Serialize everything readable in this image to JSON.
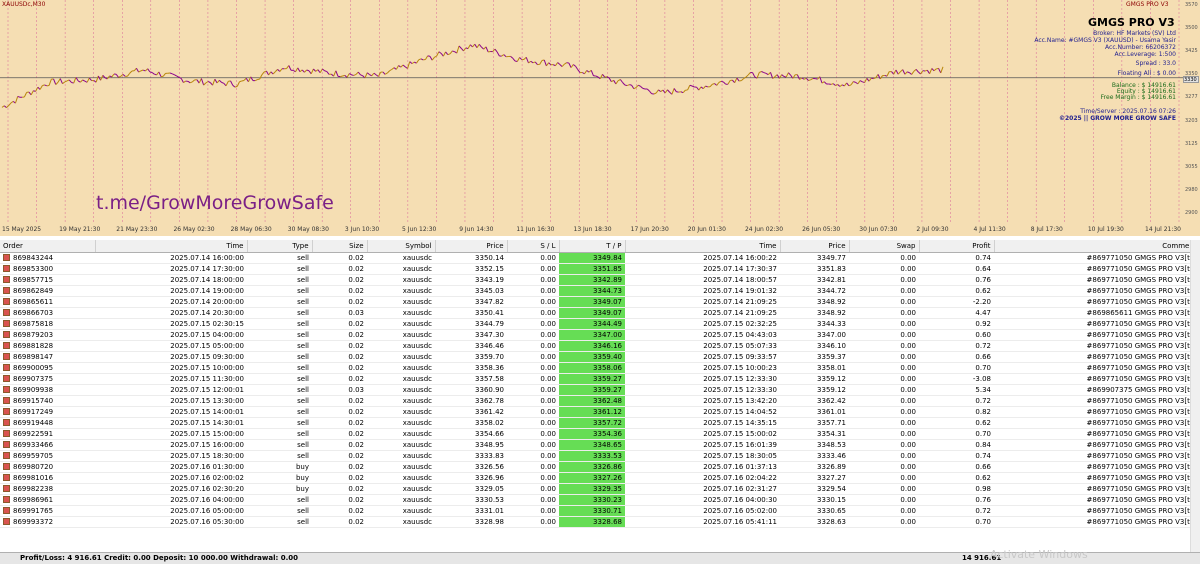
{
  "chart": {
    "symbol_label": "XAUUSDc,M30",
    "ea_label": "GMGS PRO V3",
    "watermark": "t.me/GrowMoreGrowSafe",
    "current_price": "3330",
    "y_labels": [
      "3570",
      "3500",
      "3425",
      "3350",
      "3277",
      "3203",
      "3125",
      "3055",
      "2980",
      "2900"
    ],
    "x_labels": [
      "15 May 2025",
      "19 May 21:30",
      "21 May 23:30",
      "26 May 02:30",
      "28 May 06:30",
      "30 May 08:30",
      "3 Jun 10:30",
      "5 Jun 12:30",
      "9 Jun 14:30",
      "11 Jun 16:30",
      "13 Jun 18:30",
      "17 Jun 20:30",
      "20 Jun 01:30",
      "24 Jun 02:30",
      "26 Jun 05:30",
      "30 Jun 07:30",
      "2 Jul 09:30",
      "4 Jul 11:30",
      "8 Jul 17:30",
      "10 Jul 19:30",
      "14 Jul 21:30"
    ],
    "colors": {
      "background": "#f5deb3",
      "up": "#b8860b",
      "down": "#8b008b",
      "grid": "#c71585"
    }
  },
  "panel": {
    "title": "GMGS PRO V3",
    "broker": "Broker: HF Markets (SV) Ltd",
    "acc_name": "Acc.Name: #GMGS V3 (XAUUSD) - Usama Yasir",
    "acc_number": "Acc.Number: 66206372",
    "acc_leverage": "Acc.Leverage: 1:500",
    "spread": "Spread :  33.0",
    "floating": "Floating All :  $ 0.00",
    "balance": "Balance :  $ 14916.61",
    "equity": "Equity :  $ 14916.61",
    "free_margin": "Free Margin :  $ 14916.61",
    "server_time": "Time/Server :  2025.07.16 07:26",
    "copyright": "©2025 || GROW MORE GROW SAFE"
  },
  "table": {
    "columns": [
      "Order",
      "Time",
      "Type",
      "Size",
      "Symbol",
      "Price",
      "S / L",
      "T / P",
      "Time",
      "Price",
      "Swap",
      "Profit",
      "Comment"
    ],
    "rows": [
      [
        "869843244",
        "2025.07.14 16:00:00",
        "sell",
        "0.02",
        "xauusdc",
        "3350.14",
        "0.00",
        "3349.84",
        "2025.07.14 16:00:22",
        "3349.77",
        "0.00",
        "0.74",
        "#869771050 GMGS PRO V3[tp]"
      ],
      [
        "869853300",
        "2025.07.14 17:30:00",
        "sell",
        "0.02",
        "xauusdc",
        "3352.15",
        "0.00",
        "3351.85",
        "2025.07.14 17:30:37",
        "3351.83",
        "0.00",
        "0.64",
        "#869771050 GMGS PRO V3[tp]"
      ],
      [
        "869857715",
        "2025.07.14 18:00:00",
        "sell",
        "0.02",
        "xauusdc",
        "3343.19",
        "0.00",
        "3342.89",
        "2025.07.14 18:00:57",
        "3342.81",
        "0.00",
        "0.76",
        "#869771050 GMGS PRO V3[tp]"
      ],
      [
        "869862849",
        "2025.07.14 19:00:00",
        "sell",
        "0.02",
        "xauusdc",
        "3345.03",
        "0.00",
        "3344.73",
        "2025.07.14 19:01:32",
        "3344.72",
        "0.00",
        "0.62",
        "#869771050 GMGS PRO V3[tp]"
      ],
      [
        "869865611",
        "2025.07.14 20:00:00",
        "sell",
        "0.02",
        "xauusdc",
        "3347.82",
        "0.00",
        "3349.07",
        "2025.07.14 21:09:25",
        "3348.92",
        "0.00",
        "-2.20",
        "#869771050 GMGS PRO V3[tp]"
      ],
      [
        "869866703",
        "2025.07.14 20:30:00",
        "sell",
        "0.03",
        "xauusdc",
        "3350.41",
        "0.00",
        "3349.07",
        "2025.07.14 21:09:25",
        "3348.92",
        "0.00",
        "4.47",
        "#869865611 GMGS PRO V3[tp]"
      ],
      [
        "869875818",
        "2025.07.15 02:30:15",
        "sell",
        "0.02",
        "xauusdc",
        "3344.79",
        "0.00",
        "3344.49",
        "2025.07.15 02:32:25",
        "3344.33",
        "0.00",
        "0.92",
        "#869771050 GMGS PRO V3[tp]"
      ],
      [
        "869879203",
        "2025.07.15 04:00:00",
        "sell",
        "0.02",
        "xauusdc",
        "3347.30",
        "0.00",
        "3347.00",
        "2025.07.15 04:43:03",
        "3347.00",
        "0.00",
        "0.60",
        "#869771050 GMGS PRO V3[tp]"
      ],
      [
        "869881828",
        "2025.07.15 05:00:00",
        "sell",
        "0.02",
        "xauusdc",
        "3346.46",
        "0.00",
        "3346.16",
        "2025.07.15 05:07:33",
        "3346.10",
        "0.00",
        "0.72",
        "#869771050 GMGS PRO V3[tp]"
      ],
      [
        "869898147",
        "2025.07.15 09:30:00",
        "sell",
        "0.02",
        "xauusdc",
        "3359.70",
        "0.00",
        "3359.40",
        "2025.07.15 09:33:57",
        "3359.37",
        "0.00",
        "0.66",
        "#869771050 GMGS PRO V3[tp]"
      ],
      [
        "869900095",
        "2025.07.15 10:00:00",
        "sell",
        "0.02",
        "xauusdc",
        "3358.36",
        "0.00",
        "3358.06",
        "2025.07.15 10:00:23",
        "3358.01",
        "0.00",
        "0.70",
        "#869771050 GMGS PRO V3[tp]"
      ],
      [
        "869907375",
        "2025.07.15 11:30:00",
        "sell",
        "0.02",
        "xauusdc",
        "3357.58",
        "0.00",
        "3359.27",
        "2025.07.15 12:33:30",
        "3359.12",
        "0.00",
        "-3.08",
        "#869771050 GMGS PRO V3[tp]"
      ],
      [
        "869909938",
        "2025.07.15 12:00:01",
        "sell",
        "0.03",
        "xauusdc",
        "3360.90",
        "0.00",
        "3359.27",
        "2025.07.15 12:33:30",
        "3359.12",
        "0.00",
        "5.34",
        "#869907375 GMGS PRO V3[tp]"
      ],
      [
        "869915740",
        "2025.07.15 13:30:00",
        "sell",
        "0.02",
        "xauusdc",
        "3362.78",
        "0.00",
        "3362.48",
        "2025.07.15 13:42:20",
        "3362.42",
        "0.00",
        "0.72",
        "#869771050 GMGS PRO V3[tp]"
      ],
      [
        "869917249",
        "2025.07.15 14:00:01",
        "sell",
        "0.02",
        "xauusdc",
        "3361.42",
        "0.00",
        "3361.12",
        "2025.07.15 14:04:52",
        "3361.01",
        "0.00",
        "0.82",
        "#869771050 GMGS PRO V3[tp]"
      ],
      [
        "869919448",
        "2025.07.15 14:30:01",
        "sell",
        "0.02",
        "xauusdc",
        "3358.02",
        "0.00",
        "3357.72",
        "2025.07.15 14:35:15",
        "3357.71",
        "0.00",
        "0.62",
        "#869771050 GMGS PRO V3[tp]"
      ],
      [
        "869922591",
        "2025.07.15 15:00:00",
        "sell",
        "0.02",
        "xauusdc",
        "3354.66",
        "0.00",
        "3354.36",
        "2025.07.15 15:00:02",
        "3354.31",
        "0.00",
        "0.70",
        "#869771050 GMGS PRO V3[tp]"
      ],
      [
        "869933466",
        "2025.07.15 16:00:00",
        "sell",
        "0.02",
        "xauusdc",
        "3348.95",
        "0.00",
        "3348.65",
        "2025.07.15 16:01:39",
        "3348.53",
        "0.00",
        "0.84",
        "#869771050 GMGS PRO V3[tp]"
      ],
      [
        "869959705",
        "2025.07.15 18:30:00",
        "sell",
        "0.02",
        "xauusdc",
        "3333.83",
        "0.00",
        "3333.53",
        "2025.07.15 18:30:05",
        "3333.46",
        "0.00",
        "0.74",
        "#869771050 GMGS PRO V3[tp]"
      ],
      [
        "869980720",
        "2025.07.16 01:30:00",
        "buy",
        "0.02",
        "xauusdc",
        "3326.56",
        "0.00",
        "3326.86",
        "2025.07.16 01:37:13",
        "3326.89",
        "0.00",
        "0.66",
        "#869771050 GMGS PRO V3[tp]"
      ],
      [
        "869981016",
        "2025.07.16 02:00:02",
        "buy",
        "0.02",
        "xauusdc",
        "3326.96",
        "0.00",
        "3327.26",
        "2025.07.16 02:04:22",
        "3327.27",
        "0.00",
        "0.62",
        "#869771050 GMGS PRO V3[tp]"
      ],
      [
        "869982238",
        "2025.07.16 02:30:20",
        "buy",
        "0.02",
        "xauusdc",
        "3329.05",
        "0.00",
        "3329.35",
        "2025.07.16 02:31:27",
        "3329.54",
        "0.00",
        "0.98",
        "#869771050 GMGS PRO V3[tp]"
      ],
      [
        "869986961",
        "2025.07.16 04:00:00",
        "sell",
        "0.02",
        "xauusdc",
        "3330.53",
        "0.00",
        "3330.23",
        "2025.07.16 04:00:30",
        "3330.15",
        "0.00",
        "0.76",
        "#869771050 GMGS PRO V3[tp]"
      ],
      [
        "869991765",
        "2025.07.16 05:00:00",
        "sell",
        "0.02",
        "xauusdc",
        "3331.01",
        "0.00",
        "3330.71",
        "2025.07.16 05:02:00",
        "3330.65",
        "0.00",
        "0.72",
        "#869771050 GMGS PRO V3[tp]"
      ],
      [
        "869993372",
        "2025.07.16 05:30:00",
        "sell",
        "0.02",
        "xauusdc",
        "3328.98",
        "0.00",
        "3328.68",
        "2025.07.16 05:41:11",
        "3328.63",
        "0.00",
        "0.70",
        "#869771050 GMGS PRO V3[tp]"
      ]
    ]
  },
  "footer": {
    "summary": "Profit/Loss: 4 916.61   Credit: 0.00   Deposit: 10 000.00   Withdrawal: 0.00",
    "balance": "14 916.61",
    "os_text": "Activate Windows"
  },
  "chart_data": {
    "type": "line",
    "x": [
      "15 May 2025",
      "19 May 21:30",
      "21 May 23:30",
      "26 May 02:30",
      "28 May 06:30",
      "30 May 08:30",
      "3 Jun 10:30",
      "5 Jun 12:30",
      "9 Jun 14:30",
      "11 Jun 16:30",
      "13 Jun 18:30",
      "17 Jun 20:30",
      "20 Jun 01:30",
      "24 Jun 02:30",
      "26 Jun 05:30",
      "30 Jun 07:30",
      "2 Jul 09:30",
      "4 Jul 11:30",
      "8 Jul 17:30",
      "10 Jul 19:30",
      "14 Jul 21:30"
    ],
    "series": [
      {
        "values": [
          3235,
          3315,
          3325,
          3355,
          3320,
          3310,
          3365,
          3345,
          3335,
          3390,
          3435,
          3390,
          3370,
          3320,
          3280,
          3305,
          3340,
          3335,
          3305,
          3350,
          3355
        ]
      }
    ],
    "ylim": [
      2860,
      3580
    ],
    "grid": true
  }
}
